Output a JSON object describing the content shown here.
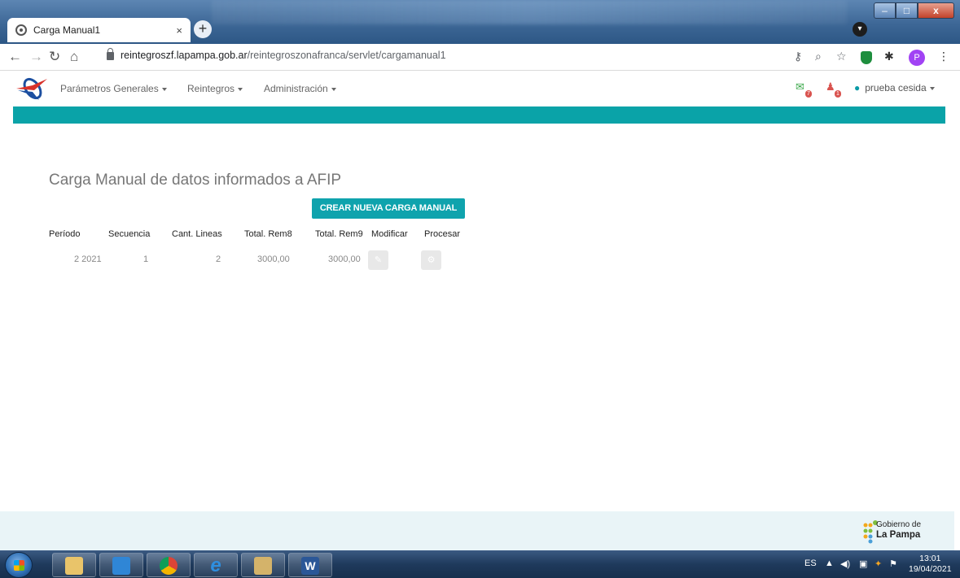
{
  "browser": {
    "tab_title": "Carga Manual1",
    "tab_close": "×",
    "new_tab": "+",
    "url_host": "reintegroszf.lapampa.gob.ar",
    "url_path": "/reintegroszonafranca/servlet/cargamanual1",
    "profile_initial": "P",
    "window_controls": {
      "minimize": "–",
      "maximize": "□",
      "close": "x"
    }
  },
  "nav": {
    "menus": [
      "Parámetros Generales",
      "Reintegros",
      "Administración"
    ],
    "mail_badge": "7",
    "alert_badge": "1",
    "user_name": "prueba cesida"
  },
  "page": {
    "title": "Carga Manual de datos informados a AFIP",
    "new_button": "CREAR NUEVA CARGA MANUAL",
    "columns": [
      "Período",
      "Secuencia",
      "Cant. Lineas",
      "Total. Rem8",
      "Total. Rem9",
      "Modificar",
      "Procesar"
    ],
    "rows": [
      {
        "periodo": "2 2021",
        "secuencia": "1",
        "cant_lineas": "2",
        "total_rem8": "3000,00",
        "total_rem9": "3000,00"
      }
    ]
  },
  "footer": {
    "logo_line1": "Gobierno de",
    "logo_line2": "La Pampa"
  },
  "taskbar": {
    "lang": "ES",
    "time": "13:01",
    "date": "19/04/2021"
  },
  "colors": {
    "teal": "#0aa3a8",
    "button": "#0fa3ad",
    "footer_bg": "#e9f4f7"
  }
}
